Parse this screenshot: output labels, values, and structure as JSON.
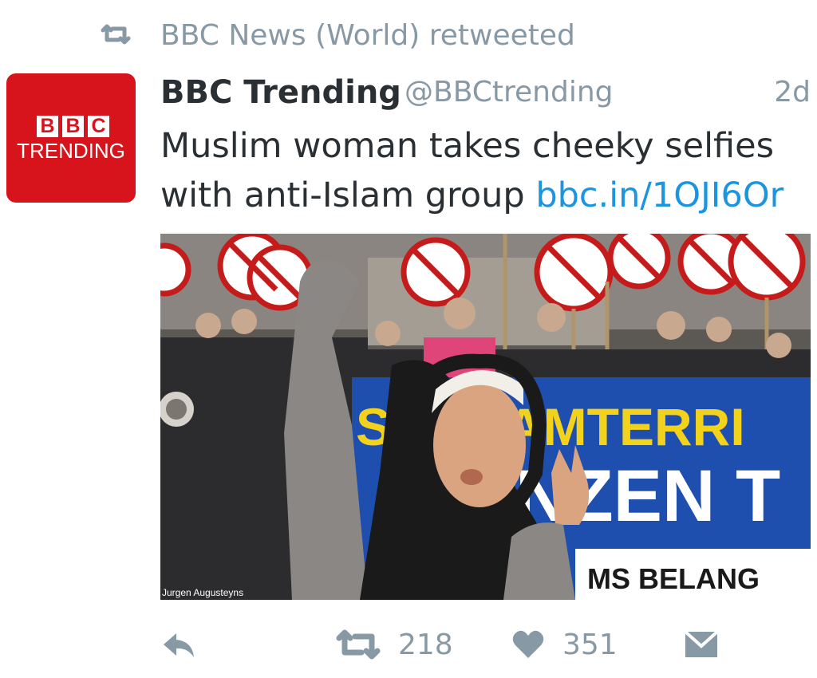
{
  "retweet_context": {
    "icon": "retweet-icon",
    "text": "BBC News (World) retweeted"
  },
  "tweet": {
    "author": {
      "display_name": "BBC Trending",
      "handle": "@BBCtrending",
      "avatar": {
        "logo_letters": [
          "B",
          "B",
          "C"
        ],
        "logo_subtext": "TRENDING",
        "background_color": "#d7131c"
      }
    },
    "time": "2d",
    "text": "Muslim woman takes cheeky selfies with anti-Islam group",
    "link": "bbc.in/1OJI6Or",
    "media": {
      "description": "Woman in hijab taking a selfie with peace sign in front of anti-Islam protesters",
      "banner_text_top": "ST  SLAMTERRI",
      "banner_text_middle": "NZEN  T",
      "banner_text_bottom": "MS BELANG",
      "photo_credit": "Jurgen Augusteyns"
    },
    "actions": {
      "reply_icon": "reply-icon",
      "retweet_icon": "retweet-icon",
      "retweet_count": "218",
      "like_icon": "heart-icon",
      "like_count": "351",
      "dm_icon": "envelope-icon"
    }
  },
  "colors": {
    "text_primary": "#292f33",
    "text_secondary": "#8899a6",
    "link": "#1b95e0",
    "brand_red": "#d7131c"
  }
}
